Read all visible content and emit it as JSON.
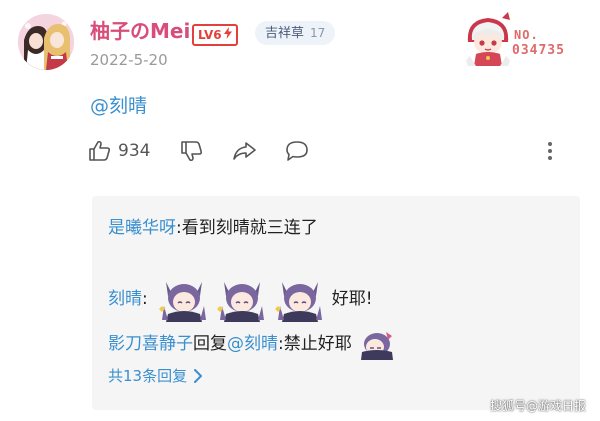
{
  "post": {
    "author": {
      "name": "柚子のMei",
      "level": "LV6",
      "level_icon": "lightning-bolt-icon",
      "tag": "吉祥草",
      "tag_count": "17",
      "avatar": "anime-girls-avatar"
    },
    "date": "2022-5-20",
    "floor_badge": {
      "label": "NO.",
      "number": "034735",
      "image": "chibi-anime-character"
    },
    "content": "@刻晴",
    "actions": {
      "like_icon": "thumbs-up-icon",
      "like_count": "934",
      "dislike_icon": "thumbs-down-icon",
      "share_icon": "share-arrow-icon",
      "comment_icon": "comment-bubble-icon",
      "more_icon": "vertical-ellipsis-icon"
    }
  },
  "replies": [
    {
      "author": "是曦华呀",
      "separator": ": ",
      "text": "看到刻晴就三连了"
    },
    {
      "author": "刻晴",
      "separator": ": ",
      "emotes": [
        "keqing-emote",
        "keqing-emote",
        "keqing-emote"
      ],
      "text": "好耶!"
    },
    {
      "author": "影刀喜静子",
      "reply_word": " 回复 ",
      "target": "@刻晴",
      "separator": " :",
      "text": "禁止好耶",
      "emote": "keqing-emote"
    }
  ],
  "more_replies": "共13条回复",
  "more_icon": "chevron-right-icon",
  "watermark": "搜狐号@游戏日报",
  "colors": {
    "username": "#d84d7a",
    "link": "#3a8fcf",
    "level_badge": "#e2413b",
    "reply_bg": "#f5f5f5",
    "date": "#999999"
  }
}
